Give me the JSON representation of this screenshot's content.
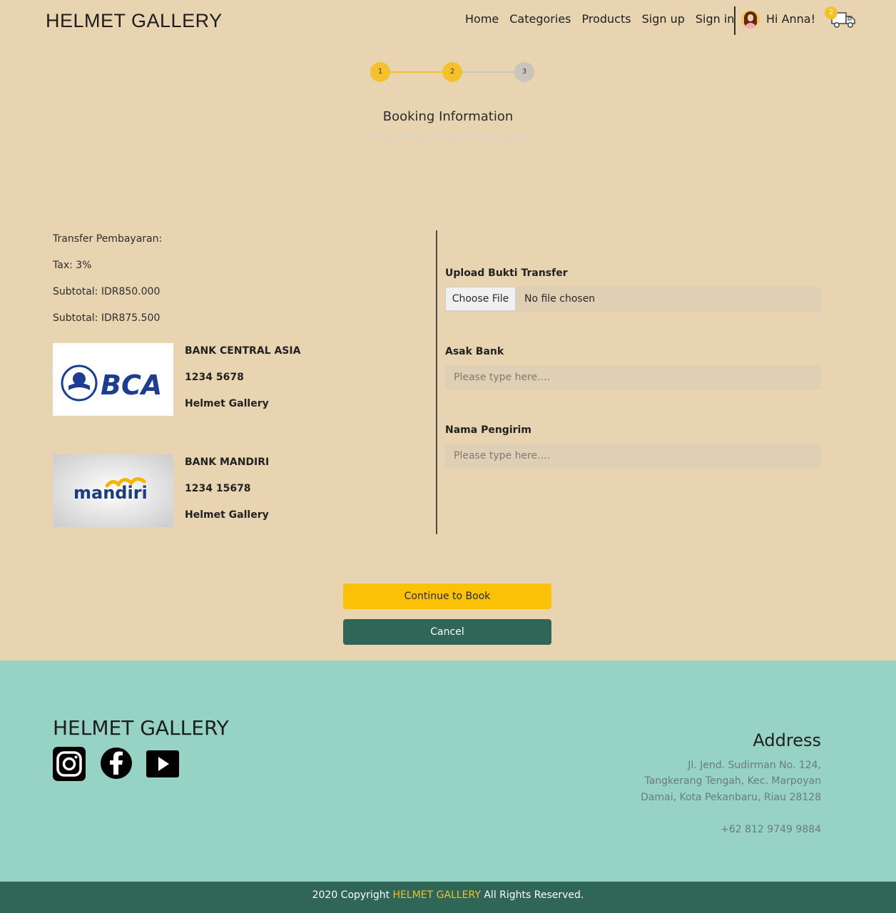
{
  "header": {
    "brand": "HELMET GALLERY",
    "nav": [
      "Home",
      "Categories",
      "Products",
      "Sign up",
      "Sign in"
    ],
    "greeting": "Hi Anna!",
    "cart_count": "2"
  },
  "stepper": {
    "steps": [
      "1",
      "2",
      "3"
    ],
    "active_step": 2
  },
  "booking": {
    "title": "Booking Information",
    "subtitle": "Please fill up the blank fields below"
  },
  "payment": {
    "transfer_label": "Transfer Pembayaran:",
    "tax": "Tax: 3%",
    "subtotal": "Subtotal: IDR850.000",
    "total": "Subtotal: IDR875.500"
  },
  "banks": [
    {
      "logo_text": "BCA",
      "name": "BANK CENTRAL ASIA",
      "account": "1234 5678",
      "holder": "Helmet Gallery"
    },
    {
      "logo_text": "mandiri",
      "name": "BANK MANDIRI",
      "account": "1234 15678",
      "holder": "Helmet Gallery"
    }
  ],
  "form": {
    "upload_label": "Upload Bukti Transfer",
    "file_button": "Choose File",
    "file_status": "No file chosen",
    "bank_label": "Asak Bank",
    "bank_placeholder": "Please type here....",
    "sender_label": "Nama Pengirim",
    "sender_placeholder": "Please type here...."
  },
  "buttons": {
    "continue": "Continue to Book",
    "cancel": "Cancel"
  },
  "footer": {
    "brand": "HELMET GALLERY",
    "address_title": "Address",
    "address_lines": [
      "Jl. Jend. Sudirman No. 124,",
      "Tangkerang Tengah, Kec. Marpoyan",
      "Damai, Kota Pekanbaru, Riau 28128"
    ],
    "phone": "+62 812 9749 9884",
    "social_icons": [
      "instagram-icon",
      "facebook-icon",
      "youtube-icon"
    ],
    "copyright_prefix": "2020 Copyright",
    "copyright_brand": "HELMET GALLERY",
    "copyright_suffix": "All Rights Reserved."
  },
  "colors": {
    "page_bg": "#e8d4b0",
    "accent_yellow": "#fbc106",
    "dark_green": "#2f6657",
    "footer_bg": "#96d3c4"
  }
}
